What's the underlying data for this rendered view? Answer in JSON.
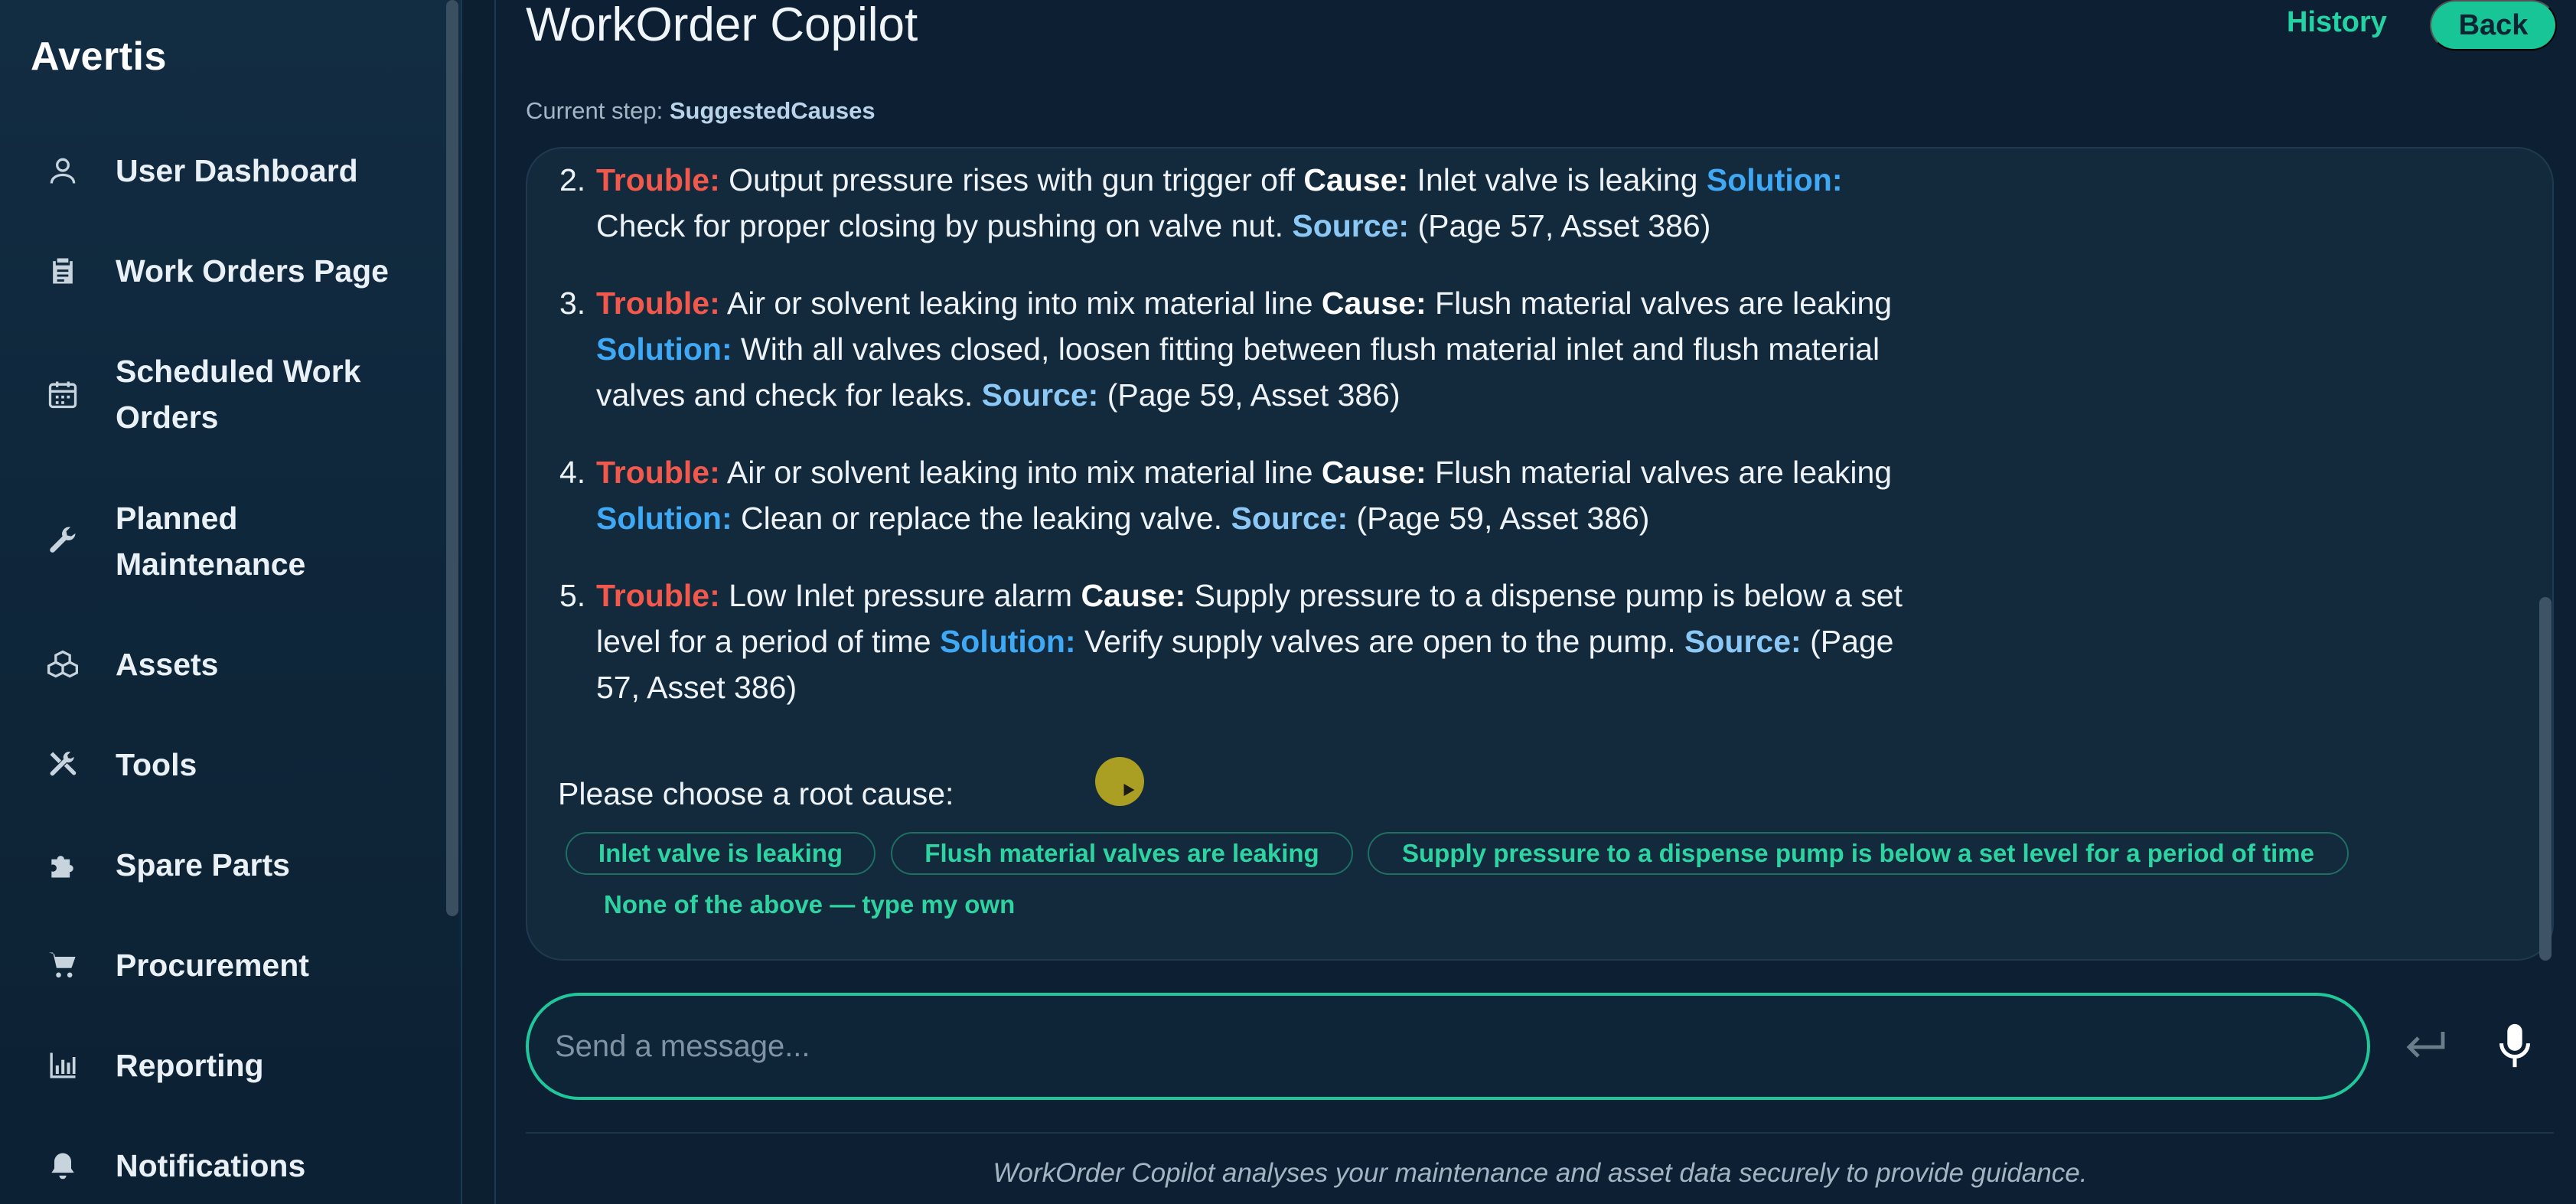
{
  "brand": "Avertis",
  "sidebar": {
    "items": [
      {
        "label": "User Dashboard",
        "icon": "user-icon"
      },
      {
        "label": "Work Orders Page",
        "icon": "clipboard-icon"
      },
      {
        "label": "Scheduled Work Orders",
        "icon": "calendar-icon"
      },
      {
        "label": "Planned Maintenance",
        "icon": "wrench-icon"
      },
      {
        "label": "Assets",
        "icon": "boxes-icon"
      },
      {
        "label": "Tools",
        "icon": "tools-icon"
      },
      {
        "label": "Spare Parts",
        "icon": "puzzle-icon"
      },
      {
        "label": "Procurement",
        "icon": "cart-icon"
      },
      {
        "label": "Reporting",
        "icon": "bar-chart-icon"
      },
      {
        "label": "Notifications",
        "icon": "bell-icon"
      }
    ]
  },
  "header": {
    "title": "WorkOrder Copilot",
    "history": "History",
    "back": "Back",
    "step_label": "Current step:",
    "step_value": "SuggestedCauses"
  },
  "labels": {
    "trouble": "Trouble:",
    "cause": "Cause:",
    "solution": "Solution:",
    "source": "Source:"
  },
  "issues": [
    {
      "num": "2.",
      "trouble": "Output pressure rises with gun trigger off",
      "cause": "Inlet valve is leaking",
      "solution": "Check for proper closing by pushing on valve nut.",
      "source": "(Page 57, Asset 386)"
    },
    {
      "num": "3.",
      "trouble": "Air or solvent leaking into mix material line",
      "cause": "Flush material valves are leaking",
      "solution": "With all valves closed, loosen fitting between flush material inlet and flush material valves and check for leaks.",
      "source": "(Page 59, Asset 386)"
    },
    {
      "num": "4.",
      "trouble": "Air or solvent leaking into mix material line",
      "cause": "Flush material valves are leaking",
      "solution": "Clean or replace the leaking valve.",
      "source": "(Page 59, Asset 386)"
    },
    {
      "num": "5.",
      "trouble": "Low Inlet pressure alarm",
      "cause": "Supply pressure to a dispense pump is below a set level for a period of time",
      "solution": "Verify supply valves are open to the pump.",
      "source": "(Page 57, Asset 386)"
    }
  ],
  "prompt": "Please choose a root cause:",
  "choices": [
    "Inlet valve is leaking",
    "Flush material valves are leaking",
    "Supply pressure to a dispense pump is below a set level for a period of time"
  ],
  "choice_other": "None of the above — type my own",
  "composer": {
    "placeholder": "Send a message..."
  },
  "footer": "WorkOrder Copilot analyses your maintenance and asset data securely to provide guidance.",
  "colors": {
    "accent": "#1fc79a",
    "trouble": "#f2584b",
    "solution": "#3fa9f5",
    "source": "#8cc8f6"
  }
}
